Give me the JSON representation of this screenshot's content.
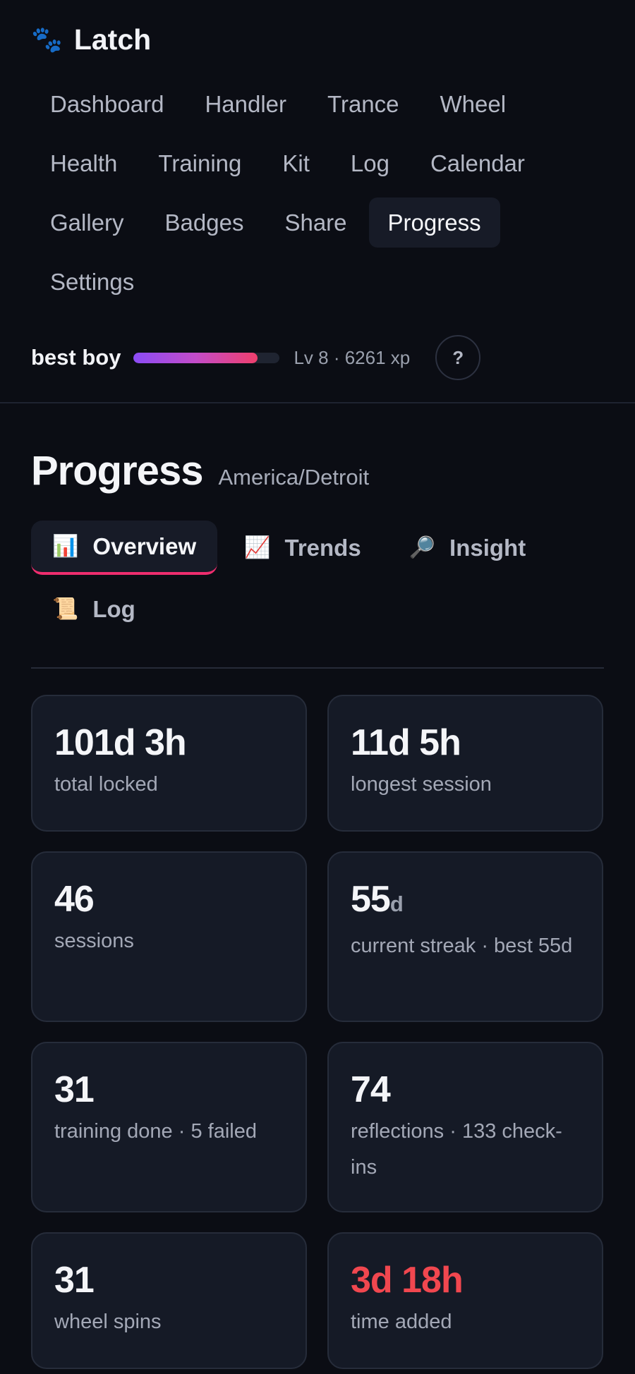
{
  "app": {
    "name": "Latch",
    "icon": "paw-icon"
  },
  "nav": {
    "items": [
      {
        "label": "Dashboard"
      },
      {
        "label": "Handler"
      },
      {
        "label": "Trance"
      },
      {
        "label": "Wheel"
      },
      {
        "label": "Health"
      },
      {
        "label": "Training"
      },
      {
        "label": "Kit"
      },
      {
        "label": "Log"
      },
      {
        "label": "Calendar"
      },
      {
        "label": "Gallery"
      },
      {
        "label": "Badges"
      },
      {
        "label": "Share"
      },
      {
        "label": "Progress"
      },
      {
        "label": "Settings"
      }
    ],
    "active": "Progress"
  },
  "user": {
    "name": "best boy",
    "xp_progress": 0.85,
    "level_text": "Lv 8 · 6261 xp",
    "help_label": "?"
  },
  "page": {
    "title": "Progress",
    "timezone": "America/Detroit"
  },
  "tabs": [
    {
      "icon": "📊",
      "label": "Overview",
      "active": true
    },
    {
      "icon": "📈",
      "label": "Trends",
      "active": false
    },
    {
      "icon": "🔎",
      "label": "Insight",
      "active": false
    },
    {
      "icon": "📜",
      "label": "Log",
      "active": false
    }
  ],
  "stats": [
    {
      "value": "101d 3h",
      "label": "total locked"
    },
    {
      "value": "11d 5h",
      "label": "longest session"
    },
    {
      "value": "46",
      "label": "sessions"
    },
    {
      "value": "55",
      "unit": "d",
      "label": "current streak · best 55d"
    },
    {
      "value": "31",
      "label": "training done · 5 failed"
    },
    {
      "value": "74",
      "label": "reflections · 133 check-ins"
    },
    {
      "value": "31",
      "label": "wheel spins"
    },
    {
      "value": "3d 18h",
      "label": "time added"
    }
  ],
  "colors": {
    "background": "#0b0d14",
    "card": "#151a26",
    "accent": "#ef2d6e",
    "alert": "#f1474f"
  }
}
